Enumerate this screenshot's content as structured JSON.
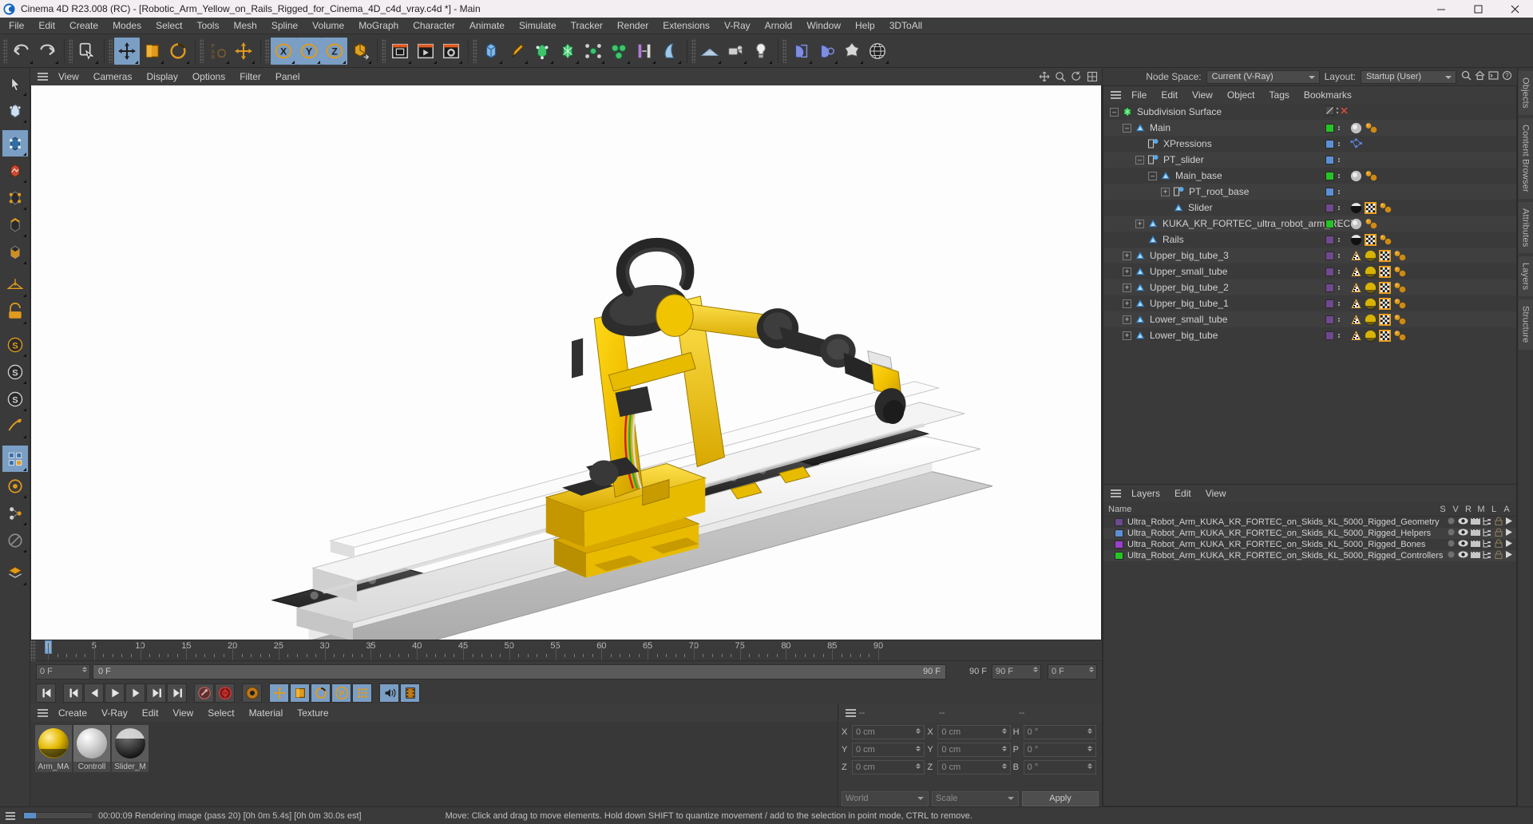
{
  "window": {
    "title": "Cinema 4D R23.008 (RC) - [Robotic_Arm_Yellow_on_Rails_Rigged_for_Cinema_4D_c4d_vray.c4d *] - Main",
    "app_icon": "cinema4d-logo-icon",
    "minimize": "minimize-icon",
    "maximize": "maximize-icon",
    "close": "close-icon"
  },
  "menubar": {
    "items": [
      "File",
      "Edit",
      "Create",
      "Modes",
      "Select",
      "Tools",
      "Mesh",
      "Spline",
      "Volume",
      "MoGraph",
      "Character",
      "Animate",
      "Simulate",
      "Tracker",
      "Render",
      "Extensions",
      "V-Ray",
      "Arnold",
      "Window",
      "Help",
      "3DToAll"
    ]
  },
  "header_right": {
    "node_space_label": "Node Space:",
    "node_space_value": "Current (V-Ray)",
    "layout_label": "Layout:",
    "layout_value": "Startup (User)",
    "search_icon": "search-icon",
    "home_icon": "home-icon",
    "commander_icon": "commander-icon",
    "help_icon": "help-icon"
  },
  "viewport_menu": {
    "items": [
      "View",
      "Cameras",
      "Display",
      "Options",
      "Filter",
      "Panel"
    ],
    "right_icons": [
      "pan-icon",
      "zoom-icon",
      "rotate-icon",
      "maximize-view-icon"
    ]
  },
  "toolbar": {
    "groups": [
      {
        "name": "undo-redo",
        "buttons": [
          {
            "name": "undo-button",
            "icon": "undo-icon",
            "selected": false
          },
          {
            "name": "redo-button",
            "icon": "redo-icon",
            "selected": false
          }
        ]
      },
      {
        "name": "selection",
        "buttons": [
          {
            "name": "live-selection-button",
            "icon": "live-selection-icon",
            "selected": false
          }
        ]
      },
      {
        "name": "transform",
        "buttons": [
          {
            "name": "move-tool-button",
            "icon": "move-icon",
            "selected": true
          },
          {
            "name": "scale-tool-button",
            "icon": "scale-icon",
            "selected": false
          },
          {
            "name": "rotate-tool-button",
            "icon": "rotate-icon",
            "selected": false
          }
        ]
      },
      {
        "name": "psr",
        "buttons": [
          {
            "name": "psr-lock-button",
            "icon": "psr-icon",
            "selected": false
          },
          {
            "name": "world-axis-button",
            "icon": "axis-move-icon",
            "selected": false
          }
        ]
      },
      {
        "name": "axis-lock",
        "buttons": [
          {
            "name": "lock-x-button",
            "icon": "x-axis-icon",
            "selected": true
          },
          {
            "name": "lock-y-button",
            "icon": "y-axis-icon",
            "selected": true
          },
          {
            "name": "lock-z-button",
            "icon": "z-axis-icon",
            "selected": true
          },
          {
            "name": "world-object-toggle-button",
            "icon": "world-object-icon",
            "selected": false
          }
        ]
      },
      {
        "name": "render",
        "buttons": [
          {
            "name": "render-view-button",
            "icon": "render-view-icon",
            "selected": false
          },
          {
            "name": "render-queue-button",
            "icon": "render-queue-icon",
            "selected": false
          },
          {
            "name": "render-settings-button",
            "icon": "render-settings-icon",
            "selected": false
          }
        ]
      },
      {
        "name": "primitives",
        "buttons": [
          {
            "name": "add-cube-button",
            "icon": "cube-icon",
            "selected": false
          },
          {
            "name": "add-spline-button",
            "icon": "pen-spline-icon",
            "selected": false
          },
          {
            "name": "add-generator-button",
            "icon": "generator-icon",
            "selected": false
          },
          {
            "name": "add-subdivision-surface-button",
            "icon": "subdivision-icon",
            "selected": false
          },
          {
            "name": "add-deformer-button",
            "icon": "deformer-icon",
            "selected": false
          },
          {
            "name": "add-mograph-button",
            "icon": "mograph-icon",
            "selected": false
          },
          {
            "name": "add-field-button",
            "icon": "field-icon",
            "selected": false
          },
          {
            "name": "add-scene-object-button",
            "icon": "scene-object-icon",
            "selected": false
          }
        ]
      },
      {
        "name": "scene",
        "buttons": [
          {
            "name": "add-floor-button",
            "icon": "floor-icon",
            "selected": false
          },
          {
            "name": "add-camera-button",
            "icon": "camera-icon",
            "selected": false
          },
          {
            "name": "add-light-button",
            "icon": "light-bulb-icon",
            "selected": false
          }
        ]
      },
      {
        "name": "vray",
        "buttons": [
          {
            "name": "vray-frame-buffer-button",
            "icon": "vray-fb-icon",
            "selected": false
          },
          {
            "name": "vray-render-button",
            "icon": "vray-render-icon",
            "selected": false
          },
          {
            "name": "vray-proxy-button",
            "icon": "vray-proxy-icon",
            "selected": false
          },
          {
            "name": "vray-globe-button",
            "icon": "vray-globe-icon",
            "selected": false
          }
        ]
      }
    ]
  },
  "left_toolbar": {
    "buttons": [
      {
        "name": "cursor-mode-button",
        "icon": "cursor-icon",
        "selected": false
      },
      {
        "name": "make-editable-button",
        "icon": "make-editable-icon",
        "selected": false
      },
      {
        "name": "model-mode-button",
        "icon": "model-mode-icon",
        "selected": true
      },
      {
        "name": "texture-mode-button",
        "icon": "texture-mode-icon",
        "selected": false
      },
      {
        "name": "point-mode-button",
        "icon": "point-mode-icon",
        "selected": false
      },
      {
        "name": "edge-mode-button",
        "icon": "edge-mode-icon",
        "selected": false
      },
      {
        "name": "polygon-mode-button",
        "icon": "polygon-mode-icon",
        "selected": false
      },
      {
        "name": "workplane-button",
        "icon": "workplane-icon",
        "selected": false
      },
      {
        "name": "enable-axis-button",
        "icon": "axis-lock-icon",
        "selected": false
      },
      {
        "name": "snap-button",
        "icon": "snap-s-icon",
        "selected": false
      },
      {
        "name": "quantize-button",
        "icon": "quantize-s-icon",
        "selected": false
      },
      {
        "name": "snap-settings-button",
        "icon": "snap-settings-s-icon",
        "selected": false
      },
      {
        "name": "workplane-lock-button",
        "icon": "workplane-lock-icon",
        "selected": false
      },
      {
        "name": "viewport-solo-button",
        "icon": "viewport-solo-icon",
        "selected": true
      },
      {
        "name": "solo-single-button",
        "icon": "solo-single-icon",
        "selected": false
      },
      {
        "name": "solo-hierarchy-button",
        "icon": "solo-hierarchy-icon",
        "selected": false
      },
      {
        "name": "solo-off-button",
        "icon": "solo-off-icon",
        "selected": false
      },
      {
        "name": "layer-button",
        "icon": "layer-icon",
        "selected": false
      }
    ]
  },
  "timeline": {
    "ticks": [
      0,
      5,
      10,
      15,
      20,
      25,
      30,
      35,
      40,
      45,
      50,
      55,
      60,
      65,
      70,
      75,
      80,
      85,
      90
    ],
    "current_frame": "0 F",
    "start_frame": "0 F",
    "end_frame": "90 F",
    "preview_start": "0 F",
    "preview_end": "90 F",
    "range_end_field": "90 F",
    "frame_field_right": "0 F",
    "playhead_frame": 0
  },
  "transport": {
    "buttons": [
      {
        "name": "go-to-start-button",
        "icon": "skip-start-icon",
        "active": false
      },
      {
        "name": "go-to-previous-key-button",
        "icon": "prev-key-icon",
        "active": false
      },
      {
        "name": "go-to-previous-frame-button",
        "icon": "prev-frame-icon",
        "active": false
      },
      {
        "name": "play-button",
        "icon": "play-icon",
        "active": false
      },
      {
        "name": "go-to-next-frame-button",
        "icon": "next-frame-icon",
        "active": false
      },
      {
        "name": "go-to-next-key-button",
        "icon": "next-key-icon",
        "active": false
      },
      {
        "name": "go-to-end-button",
        "icon": "skip-end-icon",
        "active": false
      },
      {
        "name": "record-active-objects-button",
        "icon": "record-key-icon",
        "active": false
      },
      {
        "name": "autokeying-button",
        "icon": "autokey-icon",
        "active": false
      },
      {
        "name": "keyframe-selection-button",
        "icon": "keyframe-select-icon",
        "active": false
      },
      {
        "name": "position-key-button",
        "icon": "position-key-icon",
        "active": true
      },
      {
        "name": "scale-key-button",
        "icon": "scale-key-icon",
        "active": true
      },
      {
        "name": "rotation-key-button",
        "icon": "rotation-key-icon",
        "active": true
      },
      {
        "name": "parameter-key-button",
        "icon": "parameter-key-icon",
        "active": true
      },
      {
        "name": "point-level-animation-button",
        "icon": "pla-icon",
        "active": true
      },
      {
        "name": "sound-button",
        "icon": "sound-icon",
        "active": true
      },
      {
        "name": "filmstrip-button",
        "icon": "filmstrip-icon",
        "active": true
      }
    ]
  },
  "material_manager": {
    "menu": [
      "Create",
      "V-Ray",
      "Edit",
      "View",
      "Select",
      "Material",
      "Texture"
    ],
    "materials": [
      {
        "name": "Arm_MA",
        "type": "yellow-material",
        "color": "#e3b800"
      },
      {
        "name": "Controll",
        "type": "white-material",
        "color": "#d6d6d6"
      },
      {
        "name": "Slider_M",
        "type": "black-material",
        "color": "#1a1a1a"
      }
    ]
  },
  "coordinates": {
    "headers": [
      "--",
      "--",
      "--"
    ],
    "rows": [
      {
        "pos_label": "X",
        "pos_value": "0 cm",
        "size_label": "X",
        "size_value": "0 cm",
        "rot_label": "H",
        "rot_value": "0 °"
      },
      {
        "pos_label": "Y",
        "pos_value": "0 cm",
        "size_label": "Y",
        "size_value": "0 cm",
        "rot_label": "P",
        "rot_value": "0 °"
      },
      {
        "pos_label": "Z",
        "pos_value": "0 cm",
        "size_label": "Z",
        "size_value": "0 cm",
        "rot_label": "B",
        "rot_value": "0 °"
      }
    ],
    "system": "World",
    "mode": "Scale",
    "apply": "Apply"
  },
  "object_manager": {
    "menu": [
      "File",
      "Edit",
      "View",
      "Object",
      "Tags",
      "Bookmarks"
    ],
    "rows": [
      {
        "label": "Subdivision Surface",
        "indent": 0,
        "icon": "subdivision-surface-icon",
        "icon_color": "#2ec94a",
        "expander": "collapse",
        "swatch": null,
        "dots": false,
        "tags": [],
        "special": "disable-cross"
      },
      {
        "label": "Main",
        "indent": 1,
        "icon": "null-object-icon",
        "icon_color": "#5aa8e8",
        "expander": "collapse",
        "swatch": "#23c423",
        "dots": true,
        "tags": [
          "sphere-material-tag",
          "orange-dots-tag"
        ]
      },
      {
        "label": "XPressions",
        "indent": 2,
        "icon": "xpresso-tag-icon",
        "icon_color": "#5aa8e8",
        "expander": "none",
        "swatch": "#5d8fd6",
        "dots": true,
        "tags": [
          "xpresso-node-tag"
        ]
      },
      {
        "label": "PT_slider",
        "indent": 2,
        "icon": "xpresso-tag-icon",
        "icon_color": "#5aa8e8",
        "expander": "collapse",
        "swatch": "#5d8fd6",
        "dots": true,
        "tags": []
      },
      {
        "label": "Main_base",
        "indent": 3,
        "icon": "null-object-icon",
        "icon_color": "#5aa8e8",
        "expander": "collapse",
        "swatch": "#23c423",
        "dots": true,
        "tags": [
          "sphere-material-tag",
          "orange-dots-tag"
        ]
      },
      {
        "label": "PT_root_base",
        "indent": 4,
        "icon": "xpresso-tag-icon",
        "icon_color": "#5aa8e8",
        "expander": "expand",
        "swatch": "#5d8fd6",
        "dots": true,
        "tags": []
      },
      {
        "label": "Slider",
        "indent": 4,
        "icon": "null-object-icon",
        "icon_color": "#5aa8e8",
        "expander": "none",
        "swatch": "#6b4a8f",
        "dots": true,
        "tags": [
          "black-material-tag",
          "checker-tag",
          "orange-dots-tag"
        ]
      },
      {
        "label": "KUKA_KR_FORTEC_ultra_robot_arm_RECT",
        "indent": 2,
        "icon": "null-object-icon",
        "icon_color": "#5aa8e8",
        "expander": "expand",
        "swatch": "#23c423",
        "dots": true,
        "tags": [
          "sphere-material-tag",
          "orange-dots-tag"
        ]
      },
      {
        "label": "Rails",
        "indent": 2,
        "icon": "null-object-icon",
        "icon_color": "#5aa8e8",
        "expander": "none",
        "swatch": "#6b4a8f",
        "dots": true,
        "tags": [
          "black-material-tag",
          "checker-tag",
          "orange-dots-tag"
        ]
      },
      {
        "label": "Upper_big_tube_3",
        "indent": 1,
        "icon": "null-object-icon",
        "icon_color": "#5aa8e8",
        "expander": "expand",
        "swatch": "#6b4a8f",
        "dots": true,
        "tags": [
          "checker-cone-tag",
          "yellow-material-tag",
          "checker-tag",
          "orange-dots-tag"
        ]
      },
      {
        "label": "Upper_small_tube",
        "indent": 1,
        "icon": "null-object-icon",
        "icon_color": "#5aa8e8",
        "expander": "expand",
        "swatch": "#6b4a8f",
        "dots": true,
        "tags": [
          "checker-cone-tag",
          "yellow-material-tag",
          "checker-tag",
          "orange-dots-tag"
        ]
      },
      {
        "label": "Upper_big_tube_2",
        "indent": 1,
        "icon": "null-object-icon",
        "icon_color": "#5aa8e8",
        "expander": "expand",
        "swatch": "#6b4a8f",
        "dots": true,
        "tags": [
          "checker-cone-tag",
          "yellow-material-tag",
          "checker-tag",
          "orange-dots-tag"
        ]
      },
      {
        "label": "Upper_big_tube_1",
        "indent": 1,
        "icon": "null-object-icon",
        "icon_color": "#5aa8e8",
        "expander": "expand",
        "swatch": "#6b4a8f",
        "dots": true,
        "tags": [
          "checker-cone-tag",
          "yellow-material-tag",
          "checker-tag",
          "orange-dots-tag"
        ]
      },
      {
        "label": "Lower_small_tube",
        "indent": 1,
        "icon": "null-object-icon",
        "icon_color": "#5aa8e8",
        "expander": "expand",
        "swatch": "#6b4a8f",
        "dots": true,
        "tags": [
          "checker-cone-tag",
          "yellow-material-tag",
          "checker-tag",
          "orange-dots-tag"
        ]
      },
      {
        "label": "Lower_big_tube",
        "indent": 1,
        "icon": "null-object-icon",
        "icon_color": "#5aa8e8",
        "expander": "expand",
        "swatch": "#6b4a8f",
        "dots": true,
        "tags": [
          "checker-cone-tag",
          "yellow-material-tag",
          "checker-tag",
          "orange-dots-tag"
        ]
      }
    ]
  },
  "layer_manager": {
    "menu": [
      "Layers",
      "Edit",
      "View"
    ],
    "name_header": "Name",
    "columns": [
      "S",
      "V",
      "R",
      "M",
      "L",
      "A"
    ],
    "rows": [
      {
        "color": "#6b4a8f",
        "name": "Ultra_Robot_Arm_KUKA_KR_FORTEC_on_Skids_KL_5000_Rigged_Geometry"
      },
      {
        "color": "#5d8fd6",
        "name": "Ultra_Robot_Arm_KUKA_KR_FORTEC_on_Skids_KL_5000_Rigged_Helpers"
      },
      {
        "color": "#9a3fd0",
        "name": "Ultra_Robot_Arm_KUKA_KR_FORTEC_on_Skids_KL_5000_Rigged_Bones"
      },
      {
        "color": "#23c423",
        "name": "Ultra_Robot_Arm_KUKA_KR_FORTEC_on_Skids_KL_5000_Rigged_Controllers"
      }
    ]
  },
  "vertical_tabs": [
    "Objects",
    "Content Browser",
    "Attributes",
    "Layers",
    "Structure"
  ],
  "statusbar": {
    "progress_text": "00:00:09 Rendering image (pass 20) [0h  0m  5.4s] [0h  0m 30.0s est]",
    "hint": "Move: Click and drag to move elements. Hold down SHIFT to quantize movement / add to the selection in point mode, CTRL to remove.",
    "progress_percent": 18
  },
  "colors": {
    "accent_blue": "#7a9ec4",
    "orange": "#e08a1e",
    "panel_bg": "#3a3a3a",
    "menu_bg": "#3c3c3c",
    "robot_yellow": "#f2c800"
  }
}
